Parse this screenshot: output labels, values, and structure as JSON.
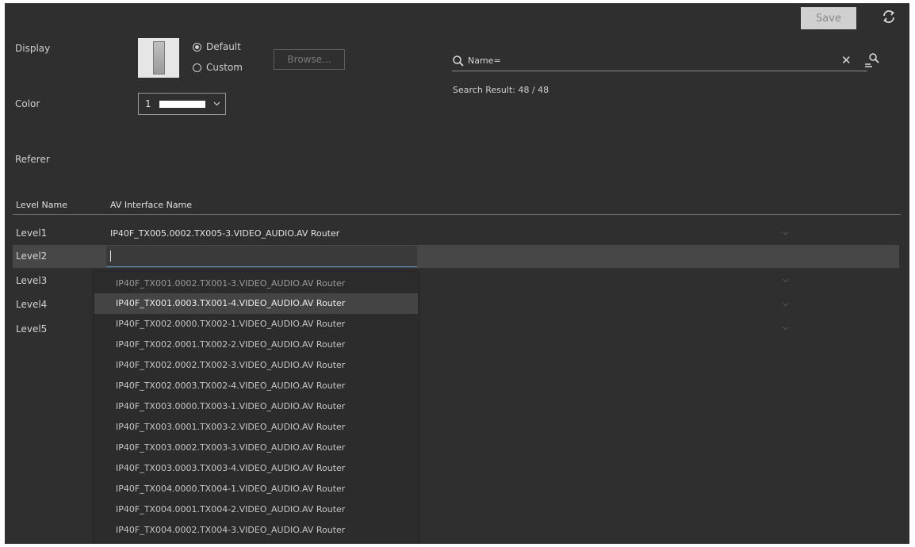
{
  "toolbar": {
    "save_label": "Save"
  },
  "display": {
    "label": "Display",
    "radio_default": "Default",
    "radio_custom": "Custom",
    "selected": "Default",
    "browse_label": "Browse..."
  },
  "color": {
    "label": "Color",
    "value": "1",
    "swatch_color": "#ffffff"
  },
  "referer": {
    "label": "Referer"
  },
  "search": {
    "value": "Name=",
    "result_text": "Search Result: 48 / 48"
  },
  "table": {
    "headers": {
      "level": "Level Name",
      "interface": "AV Interface Name"
    },
    "rows": [
      {
        "level": "Level1",
        "value": "IP40F_TX005.0002.TX005-3.VIDEO_AUDIO.AV Router"
      },
      {
        "level": "Level2",
        "value": ""
      },
      {
        "level": "Level3",
        "value": ""
      },
      {
        "level": "Level4",
        "value": ""
      },
      {
        "level": "Level5",
        "value": ""
      }
    ]
  },
  "dropdown": {
    "items": [
      "IP40F_TX001.0002.TX001-3.VIDEO_AUDIO.AV Router",
      "IP40F_TX001.0003.TX001-4.VIDEO_AUDIO.AV Router",
      "IP40F_TX002.0000.TX002-1.VIDEO_AUDIO.AV Router",
      "IP40F_TX002.0001.TX002-2.VIDEO_AUDIO.AV Router",
      "IP40F_TX002.0002.TX002-3.VIDEO_AUDIO.AV Router",
      "IP40F_TX002.0003.TX002-4.VIDEO_AUDIO.AV Router",
      "IP40F_TX003.0000.TX003-1.VIDEO_AUDIO.AV Router",
      "IP40F_TX003.0001.TX003-2.VIDEO_AUDIO.AV Router",
      "IP40F_TX003.0002.TX003-3.VIDEO_AUDIO.AV Router",
      "IP40F_TX003.0003.TX003-4.VIDEO_AUDIO.AV Router",
      "IP40F_TX004.0000.TX004-1.VIDEO_AUDIO.AV Router",
      "IP40F_TX004.0001.TX004-2.VIDEO_AUDIO.AV Router",
      "IP40F_TX004.0002.TX004-3.VIDEO_AUDIO.AV Router"
    ],
    "highlighted": "IP40F_TX001.0003.TX001-4.VIDEO_AUDIO.AV Router"
  },
  "icons": {
    "refresh": "refresh-icon",
    "search": "search-icon",
    "clear": "close-icon",
    "advanced_search": "user-search-icon",
    "chevron": "chevron-down-icon"
  },
  "colors": {
    "background": "#2f2f2f",
    "accent_underline": "#5f95c9",
    "row_highlight": "#474747"
  }
}
